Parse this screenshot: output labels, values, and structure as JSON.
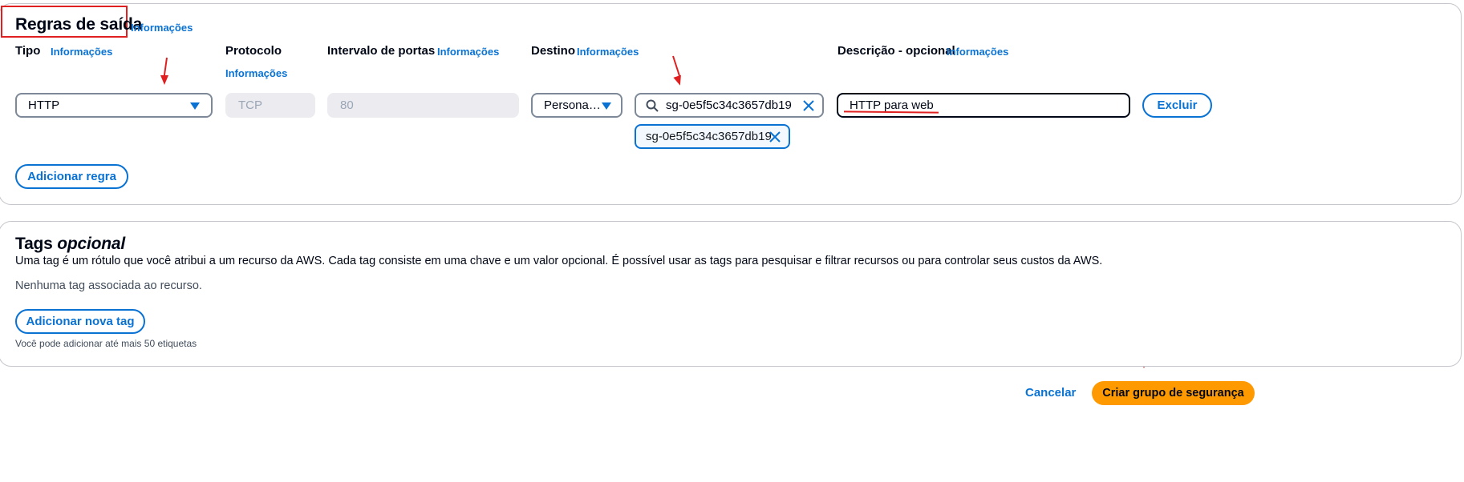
{
  "outbound": {
    "title": "Regras de saída",
    "info": "Informações",
    "cols": {
      "tipo": "Tipo",
      "protocolo": "Protocolo",
      "intervalo": "Intervalo de portas",
      "destino": "Destino",
      "descricao": "Descrição - opcional"
    },
    "row": {
      "tipo_value": "HTTP",
      "protocolo_value": "TCP",
      "porta_value": "80",
      "destino_select": "Persona…",
      "search_value": "sg-0e5f5c34c3657db19",
      "token_value": "sg-0e5f5c34c3657db19",
      "descricao_value": "HTTP para web",
      "delete_label": "Excluir"
    },
    "add_rule_label": "Adicionar regra"
  },
  "tags": {
    "title": "Tags",
    "title_optional": "opcional",
    "description": "Uma tag é um rótulo que você atribui a um recurso da AWS. Cada tag consiste em uma chave e um valor opcional. É possível usar as tags para pesquisar e filtrar recursos ou para controlar seus custos da AWS.",
    "empty": "Nenhuma tag associada ao recurso.",
    "add_label": "Adicionar nova tag",
    "limit_note": "Você pode adicionar até mais 50 etiquetas"
  },
  "footer": {
    "cancel_label": "Cancelar",
    "create_label": "Criar grupo de segurança"
  },
  "colors": {
    "accent": "#0972d3",
    "primary_button": "#ff9900",
    "annotation": "#e02020"
  }
}
